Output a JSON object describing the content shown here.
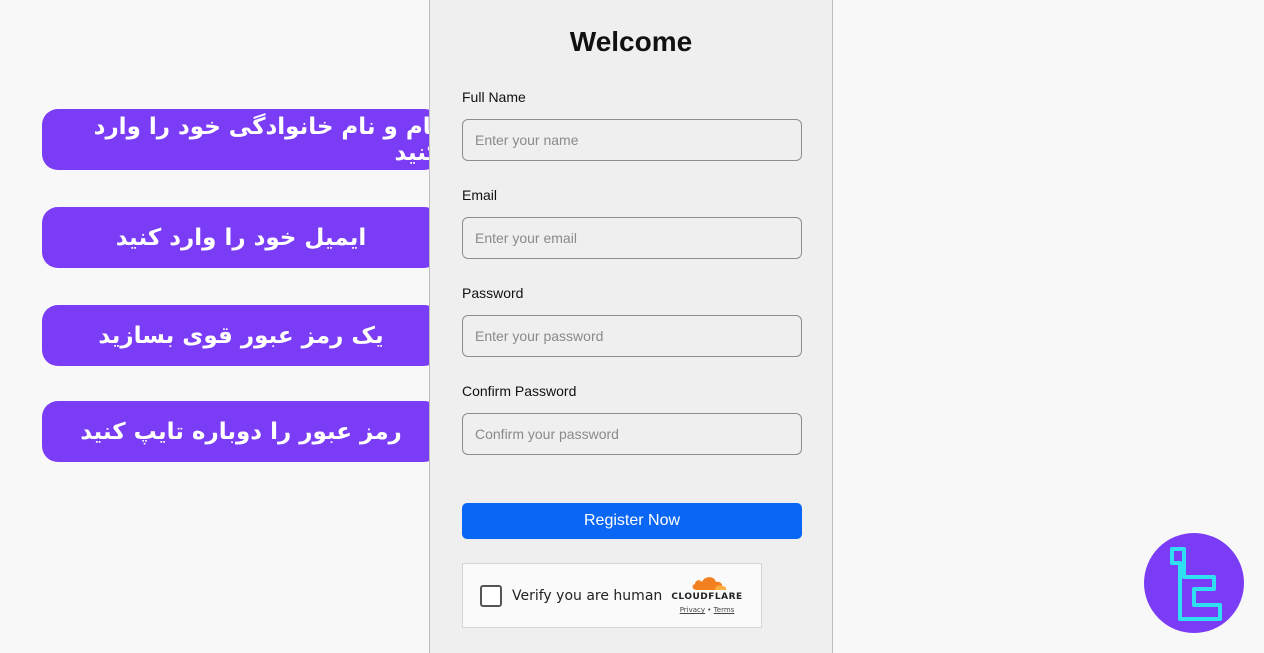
{
  "annotations": [
    "نام و نام خانوادگی خود را وارد کنید",
    "ایمیل خود را وارد کنید",
    "یک رمز عبور قوی بسازید",
    "رمز عبور را دوباره تایپ کنید"
  ],
  "form": {
    "title": "Welcome",
    "full_name": {
      "label": "Full Name",
      "placeholder": "Enter your name"
    },
    "email": {
      "label": "Email",
      "placeholder": "Enter your email"
    },
    "password": {
      "label": "Password",
      "placeholder": "Enter your password"
    },
    "confirm_password": {
      "label": "Confirm Password",
      "placeholder": "Confirm your password"
    },
    "submit_label": "Register Now"
  },
  "captcha": {
    "text": "Verify you are human",
    "brand": "CLOUDFLARE",
    "privacy_label": "Privacy",
    "separator": "•",
    "terms_label": "Terms"
  },
  "colors": {
    "annotation_bg": "#7b3cf5",
    "button_bg": "#0a66f5",
    "panel_bg": "#efefef",
    "logo_bg": "#7b3cf5",
    "logo_stroke": "#2fe0f0",
    "cloudflare_orange": "#f38020"
  },
  "icons": {
    "brand_logo": "tl-logo-icon",
    "captcha_brand": "cloudflare-cloud-icon"
  }
}
